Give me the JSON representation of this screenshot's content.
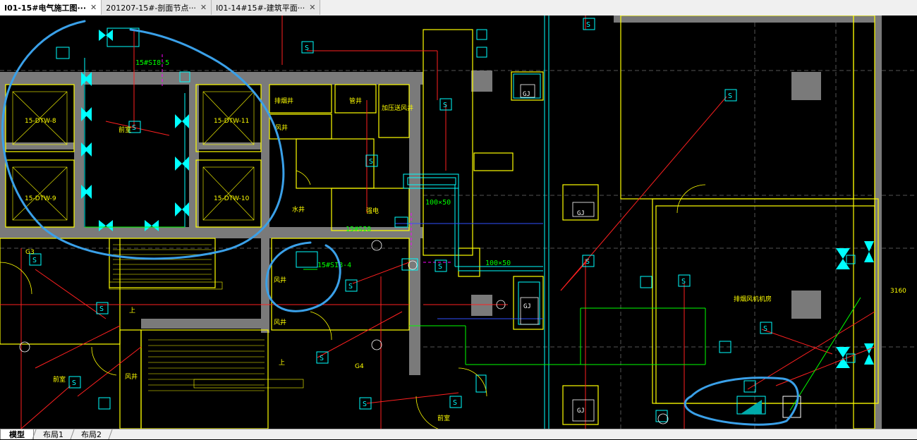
{
  "tabs": [
    {
      "label": "I01-15#电气施工图···",
      "active": true
    },
    {
      "label": "201207-15#-剖面节点···",
      "active": false
    },
    {
      "label": "I01-14#15#-建筑平面···",
      "active": false
    }
  ],
  "layouts": [
    {
      "label": "模型",
      "active": true
    },
    {
      "label": "布局1",
      "active": false
    },
    {
      "label": "布局2",
      "active": false
    }
  ],
  "drawing": {
    "elevator_labels": [
      "15-DTW-8",
      "15-DTW-11",
      "15-DTW-9",
      "15-DTW-10"
    ],
    "equipment_labels": [
      "15#SI8-5",
      "15#SI8-4",
      "15#SI8"
    ],
    "duct_sizes": [
      "100×50",
      "100×50"
    ],
    "room_labels": [
      "排烟井",
      "管井",
      "加压送风井",
      "风井",
      "水井",
      "强电",
      "风井",
      "风井",
      "风井",
      "前室",
      "前室",
      "排烟风机机房",
      "前室"
    ],
    "axis_labels": [
      "G3",
      "G4",
      "GJ",
      "GJ",
      "GJ",
      "GJ"
    ],
    "dimension_text": "3160",
    "stair_marks": [
      "上",
      "上"
    ],
    "colors": {
      "background": "#000000",
      "wall": "#ffff00",
      "cyan": "#00ffff",
      "red": "#ff0000",
      "green": "#00ff00",
      "annotation_blue": "#3aa0e8",
      "wall_fill": "#808080"
    }
  }
}
